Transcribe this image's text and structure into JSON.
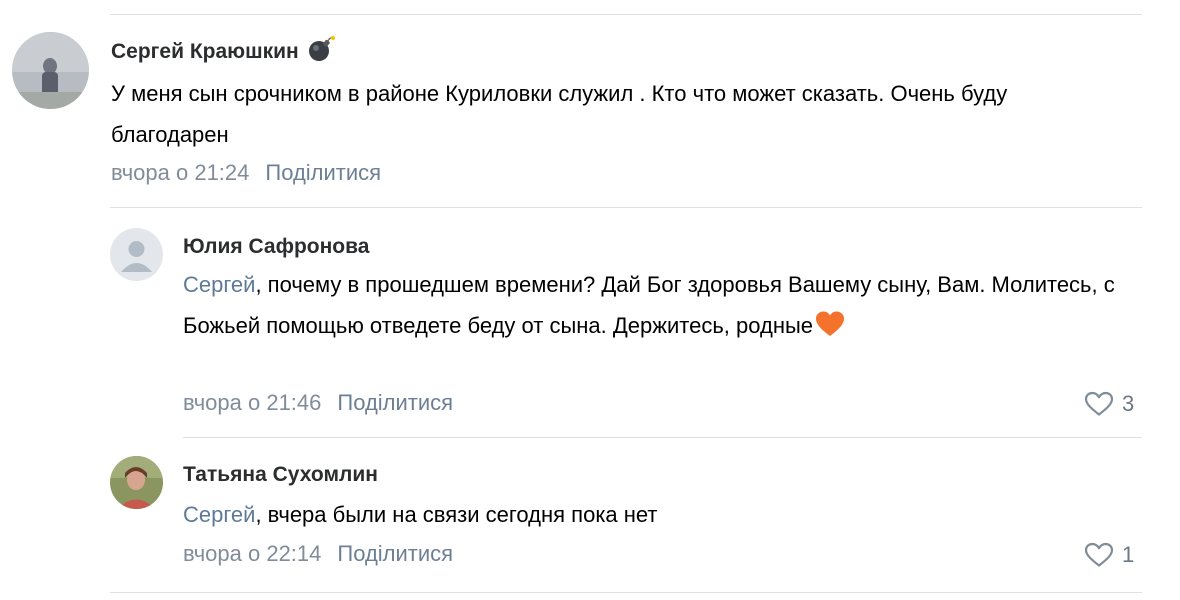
{
  "comments": [
    {
      "author": "Сергей Краюшкин",
      "badge_icon": "bomb-icon",
      "text": "У меня сын срочником в районе Куриловки служил . Кто что может сказать. Очень буду благодарен",
      "date": "вчора о 21:24",
      "share_label": "Поділитися"
    }
  ],
  "replies": [
    {
      "author": "Юлия Сафронова",
      "mention": "Сергей",
      "text": ", почему в прошедшем времени? Дай Бог здоровья Вашему сыну, Вам. Молитесь, с Божьей помощью отведете беду от сына. Держитесь, родные",
      "emoji_icon": "orange-heart-icon",
      "date": "вчора о 21:46",
      "share_label": "Поділитися",
      "likes": "3"
    },
    {
      "author": "Татьяна Сухомлин",
      "mention": "Сергей",
      "text": ", вчера были на связи сегодня пока нет",
      "date": "вчора о 22:14",
      "share_label": "Поділитися",
      "likes": "1"
    }
  ],
  "colors": {
    "link": "#5f7a99",
    "meta": "#818c99",
    "divider": "#dce1e6",
    "heart_emoji": "#f4722b"
  }
}
